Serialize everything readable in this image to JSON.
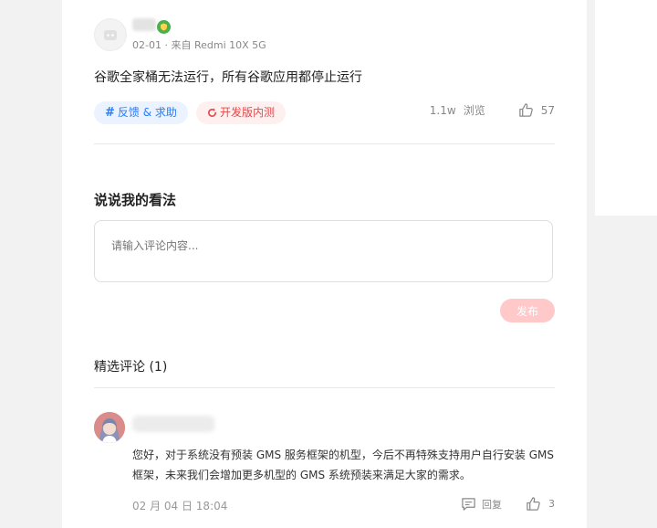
{
  "post": {
    "meta": "02-01 · 来自 Redmi 10X 5G",
    "body": "谷歌全家桶无法运行，所有谷歌应用都停止运行",
    "tags": [
      {
        "label": "反馈 & 求助",
        "icon": "hash-icon",
        "color": "#2b7cf6"
      },
      {
        "label": "开发版内测",
        "icon": "refresh-icon",
        "color": "#e5484d"
      }
    ],
    "views_value": "1.1w",
    "views_label": "浏览",
    "likes": "57"
  },
  "reply_section": {
    "title": "说说我的看法",
    "placeholder": "请输入评论内容...",
    "submit_label": "发布"
  },
  "comments_section": {
    "title": "精选评论 (1)",
    "comments": [
      {
        "text": "您好，对于系统没有预装 GMS 服务框架的机型，今后不再特殊支持用户自行安装 GMS 框架，未来我们会增加更多机型的 GMS 系统预装来满足大家的需求。",
        "date": "02 月 04 日 18:04",
        "reply_label": "回复",
        "likes": "3"
      }
    ]
  },
  "colors": {
    "accent_blue": "#2b7cf6",
    "accent_red": "#e5484d",
    "submit_disabled": "#ffc9c9",
    "verified_green": "#4caf50"
  }
}
